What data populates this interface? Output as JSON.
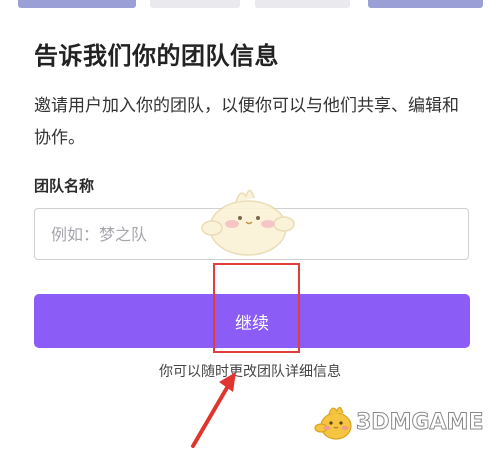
{
  "page": {
    "title": "告诉我们你的团队信息",
    "description": "邀请用户加入你的团队，以便你可以与他们共享、编辑和协作。"
  },
  "form": {
    "team_name_label": "团队名称",
    "team_name_value": "",
    "team_name_placeholder": "例如：梦之队"
  },
  "actions": {
    "continue_label": "继续"
  },
  "footer": {
    "note": "你可以随时更改团队详细信息"
  },
  "watermark": {
    "text": "3DMGAME"
  },
  "colors": {
    "accent": "#8b5cf6",
    "highlight": "#e23c3c",
    "border": "#cfcfd4"
  },
  "icons": {
    "mascot": "chick-mascot-icon",
    "arrow": "annotation-arrow-icon"
  }
}
